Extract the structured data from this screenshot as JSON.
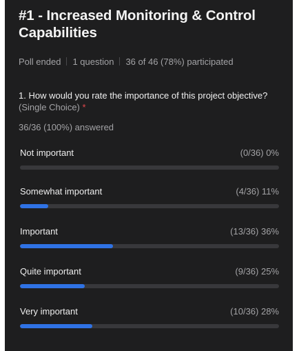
{
  "poll": {
    "title": "#1 - Increased Monitoring & Control Capabilities",
    "status": "Poll ended",
    "question_count": "1 question",
    "participation": "36 of 46 (78%) participated"
  },
  "question": {
    "text": "1. How would you rate the importance of this project objective?",
    "type": "(Single Choice)",
    "required_marker": "*",
    "answered": "36/36 (100%) answered"
  },
  "options": [
    {
      "label": "Not important",
      "result": "(0/36) 0%",
      "fraction": 0.0
    },
    {
      "label": "Somewhat important",
      "result": "(4/36) 11%",
      "fraction": 0.11
    },
    {
      "label": "Important",
      "result": "(13/36) 36%",
      "fraction": 0.36
    },
    {
      "label": "Quite important",
      "result": "(9/36) 25%",
      "fraction": 0.25
    },
    {
      "label": "Very important",
      "result": "(10/36) 28%",
      "fraction": 0.28
    }
  ],
  "colors": {
    "panel_background": "#1e1e1f",
    "bar_fill": "#2f72e4",
    "bar_track": "#38383b",
    "required_marker": "#e5484d"
  }
}
